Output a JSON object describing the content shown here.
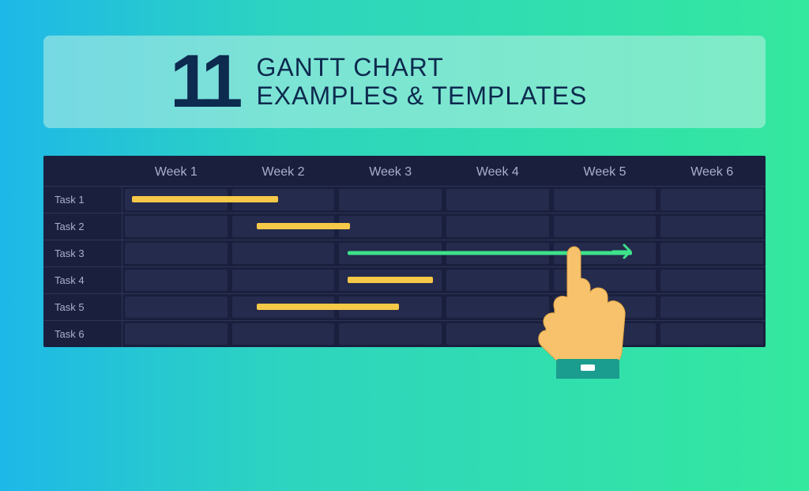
{
  "heading": {
    "number": "11",
    "line1": "GANTT CHART",
    "line2": "EXAMPLES & TEMPLATES"
  },
  "chart_data": {
    "type": "gantt",
    "title": "",
    "categories": [
      "Week 1",
      "Week 2",
      "Week 3",
      "Week 4",
      "Week 5",
      "Week 6"
    ],
    "tasks": [
      {
        "name": "Task 1",
        "start": 0.1,
        "end": 1.45,
        "color": "#f7c948"
      },
      {
        "name": "Task 2",
        "start": 1.25,
        "end": 2.12,
        "color": "#f7c948"
      },
      {
        "name": "Task 3",
        "start": 2.1,
        "end": 4.75,
        "color": "#3de28a",
        "arrow": true
      },
      {
        "name": "Task 4",
        "start": 2.1,
        "end": 2.9,
        "color": "#f7c948"
      },
      {
        "name": "Task 5",
        "start": 1.25,
        "end": 2.58,
        "color": "#f7c948"
      },
      {
        "name": "Task 6",
        "start": null,
        "end": null,
        "color": null
      }
    ],
    "xlim": [
      0,
      6
    ]
  },
  "weeks": [
    {
      "label": "Week 1"
    },
    {
      "label": "Week 2"
    },
    {
      "label": "Week 3"
    },
    {
      "label": "Week 4"
    },
    {
      "label": "Week 5"
    },
    {
      "label": "Week 6"
    }
  ],
  "rows": [
    {
      "label": "Task 1"
    },
    {
      "label": "Task 2"
    },
    {
      "label": "Task 3"
    },
    {
      "label": "Task 4"
    },
    {
      "label": "Task 5"
    },
    {
      "label": "Task 6"
    }
  ]
}
